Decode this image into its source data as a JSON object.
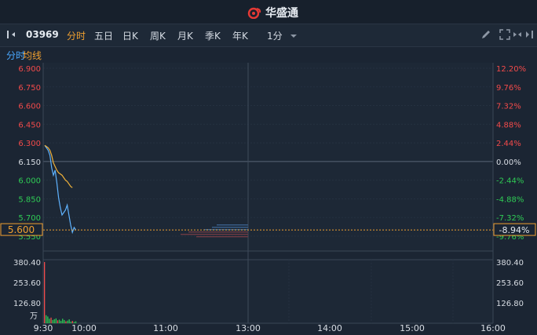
{
  "brand": {
    "name": "华盛通"
  },
  "toolbar": {
    "code": "03969",
    "tabs": [
      "分时",
      "五日",
      "日K",
      "周K",
      "月K",
      "季K",
      "年K"
    ],
    "active_tab": "分时",
    "period": "1分",
    "icons": [
      "pencil-icon",
      "fullscreen-icon",
      "swap-icon",
      "expand-panel-icon"
    ]
  },
  "subbar": {
    "fenshi": "分时",
    "junxian": "均线"
  },
  "colors": {
    "up": "#f24a4a",
    "down": "#2fcc55",
    "price_line": "#5fb3ff",
    "avg_line": "#f0b23a",
    "neutral": "#d8dde4"
  },
  "chart_data": {
    "type": "line",
    "price_axis": {
      "labels": [
        "6.900",
        "6.750",
        "6.600",
        "6.450",
        "6.300",
        "6.150",
        "6.000",
        "5.850",
        "5.700",
        "5.550"
      ],
      "ylim": [
        5.55,
        6.9
      ],
      "base": "6.150"
    },
    "percent_axis": {
      "labels": [
        "12.20%",
        "9.76%",
        "7.32%",
        "4.88%",
        "2.44%",
        "0.00%",
        "-2.44%",
        "-4.88%",
        "-7.32%",
        "-9.76%"
      ]
    },
    "current_price": "5.600",
    "current_change": "-8.94%",
    "time_labels": [
      "9:30",
      "10:00",
      "11:00",
      "13:00",
      "14:00",
      "15:00",
      "16:00"
    ],
    "series": [
      {
        "values": [
          6.28,
          6.26,
          6.24,
          6.2,
          6.1,
          6.04,
          6.08,
          5.98,
          5.86,
          5.78,
          5.72,
          5.74,
          5.76,
          5.8,
          5.72,
          5.64,
          5.58,
          5.62,
          5.6
        ]
      },
      {
        "values": [
          6.28,
          6.27,
          6.26,
          6.24,
          6.2,
          6.14,
          6.11,
          6.08,
          6.06,
          6.05,
          6.04,
          6.02,
          6.0,
          5.99,
          5.97,
          5.95,
          5.94
        ]
      }
    ],
    "volume_axis": {
      "labels": [
        "380.40",
        "253.60",
        "126.80"
      ],
      "unit": "万",
      "ylim": [
        0,
        380.4
      ]
    },
    "volume": {
      "values": [
        380.4,
        50,
        42,
        28,
        35,
        20,
        25,
        30,
        18,
        22,
        15,
        28,
        20,
        12,
        16,
        24,
        10,
        14,
        8,
        12
      ],
      "colors": [
        "red",
        "green",
        "green",
        "green",
        "red",
        "green",
        "green",
        "green",
        "red",
        "green",
        "green",
        "green",
        "green",
        "red",
        "green",
        "green",
        "green",
        "red",
        "green",
        "green"
      ]
    }
  }
}
